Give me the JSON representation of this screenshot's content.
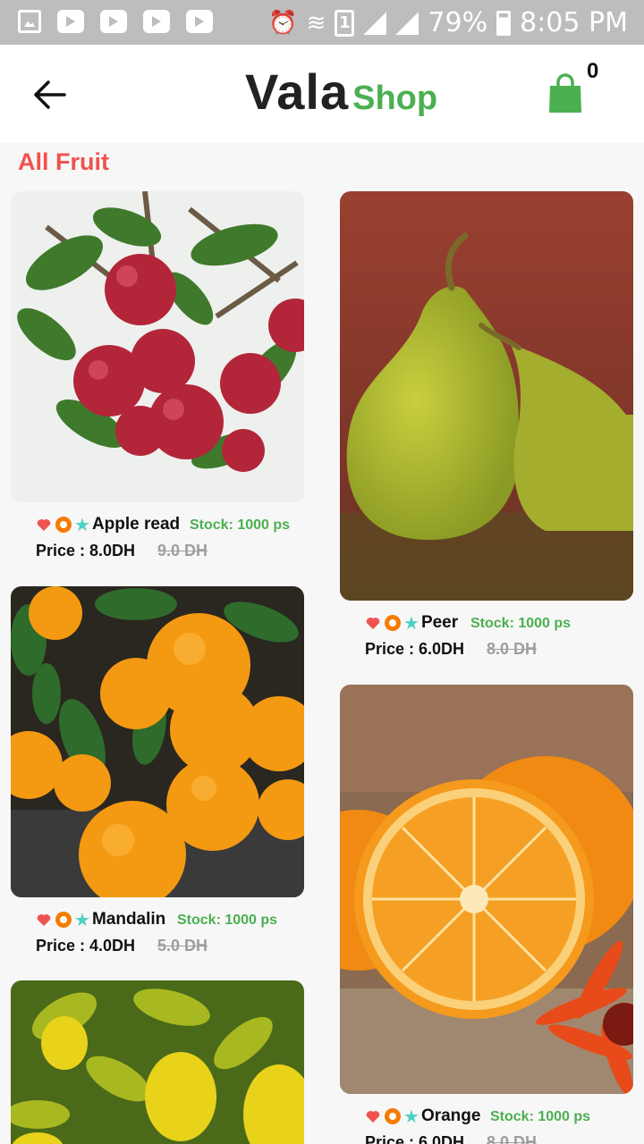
{
  "status_bar": {
    "battery": "79%",
    "time": "8:05 PM",
    "sim_slot": "1",
    "left_icons": [
      "image-notification-icon",
      "youtube-icon",
      "youtube-icon",
      "youtube-icon",
      "youtube-icon"
    ],
    "right_icons": [
      "alarm-icon",
      "wifi-icon",
      "sim-icon",
      "signal-icon",
      "signal-icon",
      "battery-charging-icon"
    ]
  },
  "app_bar": {
    "brand_primary": "Vala",
    "brand_secondary": "Shop",
    "cart_count": "0",
    "icons": [
      "back-arrow-icon",
      "shopping-bag-icon"
    ],
    "accent": "#4caf50"
  },
  "section": {
    "title": "All Fruit",
    "color": "#ef5350"
  },
  "products": [
    {
      "name": "Apple read",
      "stock": "Stock: 1000 ps",
      "price": "Price : 8.0DH",
      "old_price": "9.0 DH"
    },
    {
      "name": "Peer",
      "stock": "Stock: 1000 ps",
      "price": "Price : 6.0DH",
      "old_price": "8.0 DH"
    },
    {
      "name": "Mandalin",
      "stock": "Stock: 1000 ps",
      "price": "Price : 4.0DH",
      "old_price": "5.0 DH"
    },
    {
      "name": "Orange",
      "stock": "Stock: 1000 ps",
      "price": "Price : 6.0DH",
      "old_price": "8.0 DH"
    },
    {
      "name": "",
      "stock": "",
      "price": "",
      "old_price": ""
    }
  ],
  "product_icons": [
    "heart-icon",
    "ring-icon",
    "star-icon"
  ]
}
